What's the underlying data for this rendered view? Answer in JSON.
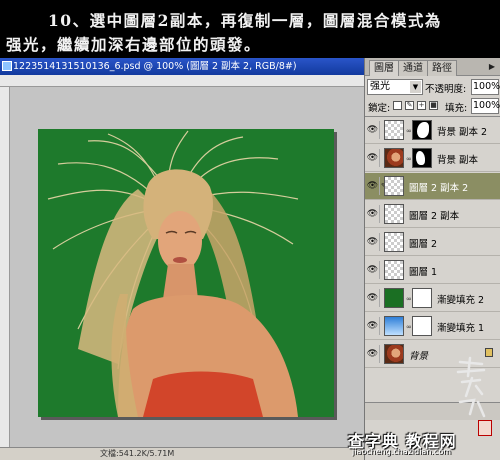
{
  "instruction": {
    "line1": "10、選中圖層2副本，再復制一層，圖層混合模式為",
    "line2": "强光，繼續加深右邊部位的頭發。"
  },
  "document": {
    "title": "1223514131510136_6.psd @ 100% (圖層 2 副本 2, RGB/8#)",
    "status": "文檔:541.2K/5.71M"
  },
  "layers_panel": {
    "tabs": [
      "圖層",
      "通道",
      "路徑"
    ],
    "active_tab": "圖層",
    "blend_mode": "强光",
    "opacity_label": "不透明度:",
    "opacity_value": "100%",
    "lock_label": "鎖定:",
    "fill_label": "填充:",
    "fill_value": "100%",
    "layers": [
      {
        "name": "背景 副本 2",
        "thumb": "checker",
        "mask": "whitehair",
        "selected": false
      },
      {
        "name": "背景 副本",
        "thumb": "photo",
        "mask": "black",
        "selected": false
      },
      {
        "name": "圖層 2 副本 2",
        "thumb": "checker",
        "mask": null,
        "selected": true
      },
      {
        "name": "圖層 2 副本",
        "thumb": "checker",
        "mask": null,
        "selected": false
      },
      {
        "name": "圖層 2",
        "thumb": "checker",
        "mask": null,
        "selected": false
      },
      {
        "name": "圖層 1",
        "thumb": "checker",
        "mask": null,
        "selected": false
      },
      {
        "name": "漸變填充 2",
        "thumb": "green",
        "mask": "white",
        "selected": false
      },
      {
        "name": "漸變填充 1",
        "thumb": "blue",
        "mask": "white",
        "selected": false
      },
      {
        "name": "背景",
        "thumb": "photo",
        "mask": null,
        "selected": false,
        "locked": true
      }
    ]
  },
  "colors": {
    "canvas_background": "#1e7a2c",
    "selected_layer": "#8b8e63",
    "titlebar": "#1f4bb8"
  },
  "watermark": {
    "text": "查字典 教程网",
    "url": "jiaocheng.chazidian.com"
  }
}
